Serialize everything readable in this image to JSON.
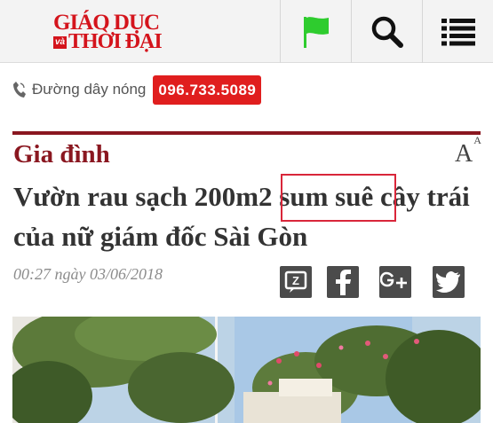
{
  "header": {
    "logo": {
      "line1": "GIÁO DỤC",
      "va": "và",
      "line2": "THỜI ĐẠI"
    },
    "icons": [
      "flag-icon",
      "search-icon",
      "menu-icon"
    ],
    "colors": {
      "logo_red": "#d4141c",
      "flag_green": "#2ecc2e",
      "background": "#f3f3f3"
    }
  },
  "hotline": {
    "label": "Đường dây nóng",
    "number": "096.733.5089",
    "number_bg": "#e01e1e"
  },
  "article": {
    "category": "Gia đình",
    "font_size_control": "A",
    "font_size_control_sup": "A",
    "title_before": "Vườn rau sạch 200m2 ",
    "title_highlight": "sum suê",
    "title_after": " cây trái của nữ giám đốc Sài Gòn",
    "date": "00:27 ngày 03/06/2018",
    "accent_color": "#8a1720",
    "highlight_border": "#d9263a"
  },
  "share": {
    "buttons": [
      "zalo-icon",
      "facebook-icon",
      "google-plus-icon",
      "twitter-icon"
    ],
    "zalo_letter": "Z"
  },
  "photo": {
    "description_icon": "garden-photo"
  }
}
